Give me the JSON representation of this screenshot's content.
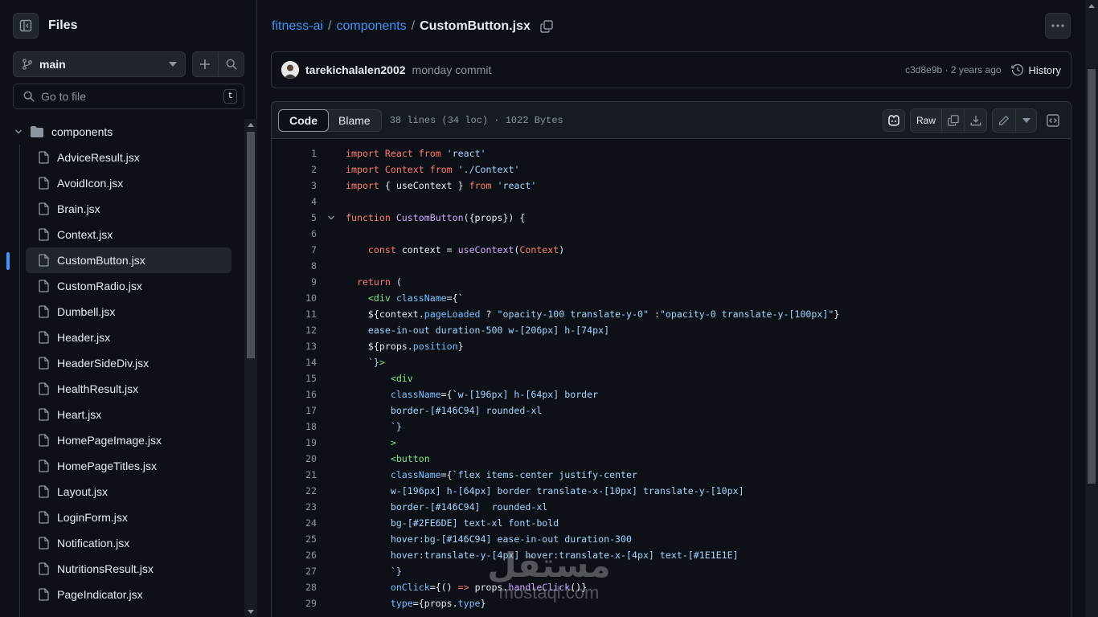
{
  "sidebar": {
    "title": "Files",
    "branch": "main",
    "search_placeholder": "Go to file",
    "search_shortcut": "t",
    "folder": "components",
    "files": [
      "AdviceResult.jsx",
      "AvoidIcon.jsx",
      "Brain.jsx",
      "Context.jsx",
      "CustomButton.jsx",
      "CustomRadio.jsx",
      "Dumbell.jsx",
      "Header.jsx",
      "HeaderSideDiv.jsx",
      "HealthResult.jsx",
      "Heart.jsx",
      "HomePageImage.jsx",
      "HomePageTitles.jsx",
      "Layout.jsx",
      "LoginForm.jsx",
      "Notification.jsx",
      "NutritionsResult.jsx",
      "PageIndicator.jsx"
    ],
    "selected_file": "CustomButton.jsx"
  },
  "breadcrumb": {
    "repo": "fitness-ai",
    "folder": "components",
    "file": "CustomButton.jsx",
    "separator": "/"
  },
  "commit": {
    "author": "tarekichalalen2002",
    "message": "monday commit",
    "meta": "c3d8e9b · 2 years ago",
    "history_label": "History"
  },
  "file": {
    "tab_code": "Code",
    "tab_blame": "Blame",
    "info": "38 lines (34 loc) · 1022 Bytes",
    "raw_label": "Raw"
  },
  "code_lines": [
    {
      "n": "1"
    },
    {
      "n": "2"
    },
    {
      "n": "3"
    },
    {
      "n": "4"
    },
    {
      "n": "5"
    },
    {
      "n": "6"
    },
    {
      "n": "7"
    },
    {
      "n": "8"
    },
    {
      "n": "9"
    },
    {
      "n": "10"
    },
    {
      "n": "11"
    },
    {
      "n": "12"
    },
    {
      "n": "13"
    },
    {
      "n": "14"
    },
    {
      "n": "15"
    },
    {
      "n": "16"
    },
    {
      "n": "17"
    },
    {
      "n": "18"
    },
    {
      "n": "19"
    },
    {
      "n": "20"
    },
    {
      "n": "21"
    },
    {
      "n": "22"
    },
    {
      "n": "23"
    },
    {
      "n": "24"
    },
    {
      "n": "25"
    },
    {
      "n": "26"
    },
    {
      "n": "27"
    },
    {
      "n": "28"
    },
    {
      "n": "29"
    }
  ],
  "code_tokens": {
    "l1": [
      "import",
      "React",
      "from",
      "'react'"
    ],
    "l2": [
      "import",
      "Context",
      "from",
      "'./Context'"
    ],
    "l3": [
      "import",
      "{ useContext }",
      "from",
      "'react'"
    ],
    "l5": [
      "function",
      "CustomButton",
      "({props}) {"
    ],
    "l7": [
      "const",
      " context = ",
      "useContext",
      "(",
      "Context",
      ")"
    ],
    "l9": [
      "return",
      " ("
    ],
    "l10": [
      "<div",
      " ",
      "className",
      "={`"
    ],
    "l11": [
      "${context.",
      "pageLoaded",
      " ? ",
      "\"opacity-100 translate-y-0\"",
      " :",
      "\"opacity-0 translate-y-[100px]\"",
      "}"
    ],
    "l12": "ease-in-out duration-500 w-[206px] h-[74px]",
    "l13": [
      "${props.",
      "position",
      "}"
    ],
    "l14": [
      "`}",
      ">"
    ],
    "l15": [
      "<div"
    ],
    "l16": [
      "className",
      "={`",
      "w-[196px] h-[64px] border"
    ],
    "l17": "border-[#146C94] rounded-xl",
    "l18": "`}",
    "l19": ">",
    "l20": [
      "<button"
    ],
    "l21": [
      "className",
      "={`",
      "flex items-center justify-center"
    ],
    "l22": "w-[196px] h-[64px] border translate-x-[10px] translate-y-[10px]",
    "l23": "border-[#146C94]  rounded-xl",
    "l24": "bg-[#2FE6DE] text-xl font-bold",
    "l25": "hover:bg-[#146C94] ease-in-out duration-300",
    "l26": "hover:translate-y-[4px] hover:translate-x-[4px] text-[#1E1E1E]",
    "l27": "`}",
    "l28": [
      "onClick",
      "={() ",
      "=>",
      " props.",
      "handleClick",
      "()}"
    ],
    "l29": [
      "type",
      "={props.",
      "type",
      "}"
    ]
  },
  "watermark": {
    "text_ar": "مستقل",
    "text_en": "mostaql.com"
  },
  "icons": {
    "sidebar_toggle": "sidebar-collapse-icon",
    "branch": "git-branch-icon",
    "add": "plus-icon",
    "search": "search-icon",
    "folder": "folder-icon",
    "file": "file-icon",
    "copy": "copy-icon",
    "more": "kebab-icon",
    "history": "history-icon",
    "copilot": "copilot-icon",
    "download": "download-icon",
    "edit": "pencil-icon",
    "symbols": "code-square-icon"
  },
  "colors": {
    "background": "#0d1117",
    "border": "#30363d",
    "link": "#4493f8",
    "keyword": "#ff7b72",
    "function": "#d2a8ff",
    "string": "#a5d6ff",
    "attribute": "#79c0ff",
    "tag": "#7ee787"
  }
}
